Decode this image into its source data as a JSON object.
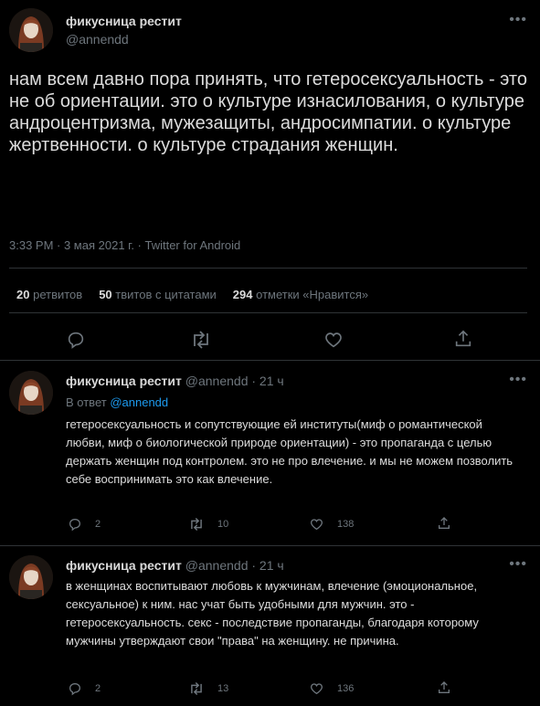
{
  "main_tweet": {
    "display_name": "фикусница рестит",
    "handle": "@annendd",
    "text": "нам всем давно пора принять, что гетеросексуальность - это не об ориентации. это о культуре изнасилования, о культуре андроцентризма, мужезащиты, андросимпатии. о культуре жертвенности. о культуре страдания женщин.",
    "meta": "3:33 PM · 3 мая 2021 г. · Twitter for Android",
    "stats": {
      "retweets_count": "20",
      "retweets_label": "ретвитов",
      "quotes_count": "50",
      "quotes_label": "твитов с цитатами",
      "likes_count": "294",
      "likes_label": "отметки «Нравится»"
    }
  },
  "replies": [
    {
      "display_name": "фикусница рестит",
      "handle": "@annendd",
      "time": "· 21 ч",
      "in_reply_label": "В ответ",
      "in_reply_handle": "@annendd",
      "text": "гетеросексуальность и сопутствующие ей институты(миф о романтической любви, миф о биологической природе ориентации) - это пропаганда с целью держать женщин под контролем. это не про влечение. и мы не можем позволить себе воспринимать это как влечение.",
      "replies_count": "2",
      "retweets_count": "10",
      "likes_count": "138"
    },
    {
      "display_name": "фикусница рестит",
      "handle": "@annendd",
      "time": "· 21 ч",
      "text": "в женщинах воспитывают любовь к мужчинам, влечение (эмоциональное, сексуальное) к ним. нас учат быть удобными для мужчин. это - гетеросексуальность. секс - последствие пропаганды, благодаря которому мужчины утверждают свои \"права\" на женщину. не причина.",
      "replies_count": "2",
      "retweets_count": "13",
      "likes_count": "136"
    }
  ],
  "colors": {
    "background": "#000000",
    "text": "#d9d9d9",
    "muted": "#6e767d",
    "link": "#1d9bf0",
    "divider": "#2f3336"
  },
  "icons": [
    "more-icon",
    "reply-icon",
    "retweet-icon",
    "like-icon",
    "share-icon"
  ]
}
